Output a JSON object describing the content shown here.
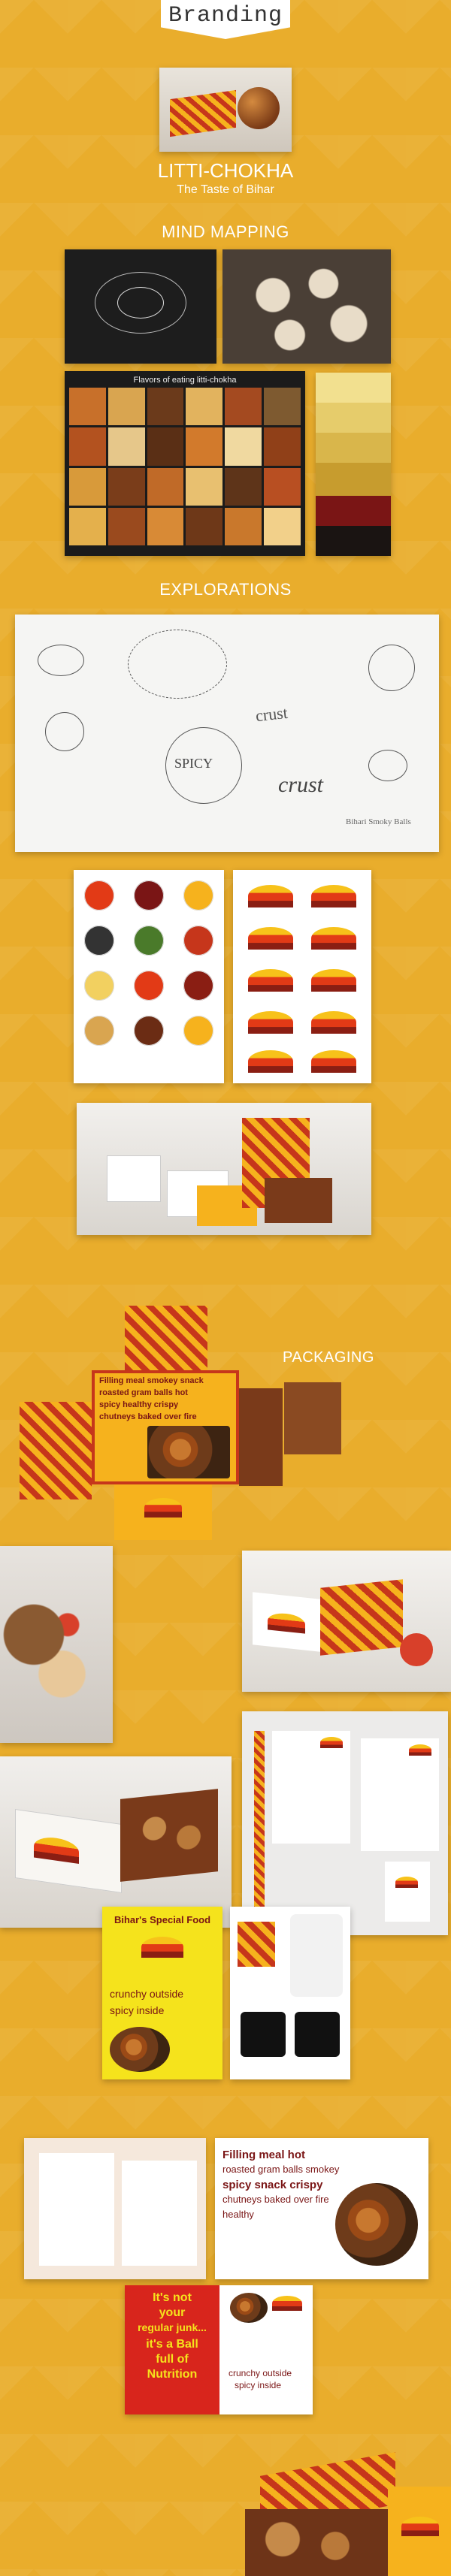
{
  "header": {
    "tab_label": "Branding",
    "brand_name": "LITTI-CHOKHA",
    "tagline": "The Taste of Bihar"
  },
  "sections": {
    "mind_mapping": "MIND MAPPING",
    "explorations": "EXPLORATIONS",
    "packaging": "PACKAGING"
  },
  "moodboard": {
    "title": "Flavors of eating litti-chokha"
  },
  "palette": {
    "colors": [
      "#f2e08f",
      "#e6cc6b",
      "#d9b64b",
      "#c79c2e",
      "#7a1515",
      "#1a1412"
    ]
  },
  "brand_marks": {
    "wordmark_1": "SPICY",
    "wordmark_2": "crust",
    "wordmark_3": "crust",
    "sketch_caption": "Bihari Smoky Balls"
  },
  "package_copy": {
    "words_line_1": "Filling meal smokey snack",
    "words_line_2": "roasted gram balls hot",
    "words_line_3": "spicy healthy crispy",
    "words_line_4": "chutneys baked over fire"
  },
  "poster_1": {
    "heading": "Bihar's Special Food",
    "line_1": "crunchy outside",
    "line_2": "spicy inside"
  },
  "brochure_right": {
    "line_1": "Filling meal hot",
    "line_2": "roasted gram balls smokey",
    "line_3": "spicy snack crispy",
    "line_4": "chutneys baked over fire",
    "line_5": "healthy"
  },
  "poster_2": {
    "line_1": "It's not",
    "line_2": "your",
    "line_3": "regular junk...",
    "line_4": "it's a Ball",
    "line_5": "full of",
    "line_6": "Nutrition",
    "small_1": "crunchy outside",
    "small_2": "spicy inside"
  },
  "colors": {
    "background": "#e9ad2c",
    "brand_red": "#c6361b",
    "brand_yellow": "#f6b21d",
    "deep_brown": "#7a3a1a"
  }
}
